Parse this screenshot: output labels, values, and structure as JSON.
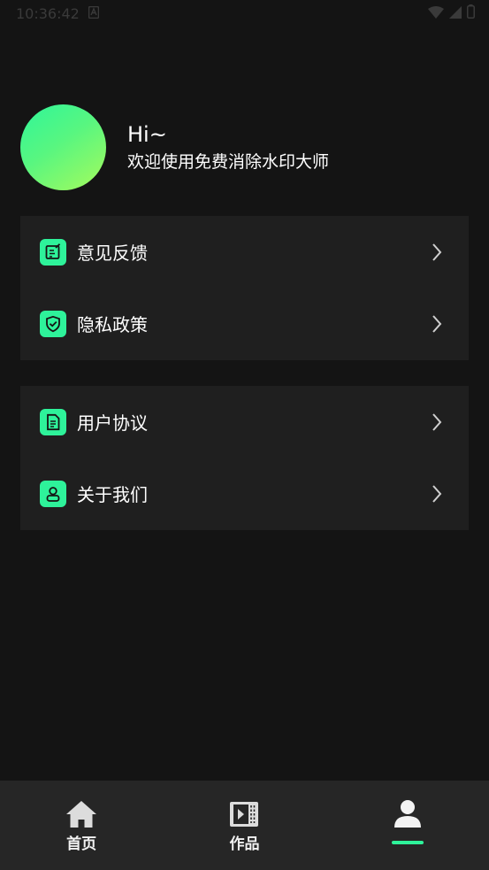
{
  "status_bar": {
    "time": "10:36:42"
  },
  "profile": {
    "greeting": "Hi~",
    "subtitle": "欢迎使用免费消除水印大师"
  },
  "menu": {
    "group1": [
      {
        "label": "意见反馈",
        "icon": "feedback-icon"
      },
      {
        "label": "隐私政策",
        "icon": "shield-icon"
      }
    ],
    "group2": [
      {
        "label": "用户协议",
        "icon": "document-icon"
      },
      {
        "label": "关于我们",
        "icon": "user-card-icon"
      }
    ]
  },
  "tabs": [
    {
      "label": "首页",
      "icon": "home-icon",
      "active": false
    },
    {
      "label": "作品",
      "icon": "video-icon",
      "active": false
    },
    {
      "label": "",
      "icon": "person-icon",
      "active": true
    }
  ],
  "colors": {
    "accent": "#2ef29a",
    "background": "#141414",
    "card": "#1f1f1f",
    "tab_bar": "#262626"
  }
}
